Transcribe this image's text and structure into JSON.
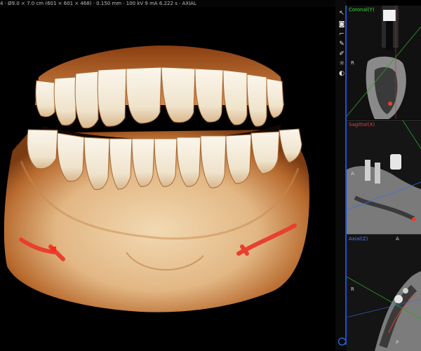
{
  "app": {
    "info_text": "4 · Ø9.0 × 7.0 cm (601 × 601 × 468) · 0.150 mm · 100 kV 9 mA 6.222 s · AXIAL"
  },
  "toolbar": {
    "icons": [
      "cursor-icon",
      "camera-icon",
      "ruler-icon",
      "wrench-icon",
      "pen-icon",
      "brightness-icon",
      "contrast-icon",
      "layers-icon"
    ]
  },
  "panels": {
    "coronal": {
      "label": "Coronal(Y)",
      "label_color": "#3ddc3d",
      "marker_left": "R"
    },
    "sagittal": {
      "label": "Sagittal(X)",
      "label_color": "#e04040",
      "marker_left": "A"
    },
    "axial": {
      "label": "Axial(Z)",
      "label_color": "#4a7dff",
      "marker_top": "A",
      "marker_left": "R",
      "marker_bottom": "P"
    }
  },
  "colors": {
    "bone": "#e8c79a",
    "enamel": "#f4eee2",
    "nerve_canal": "#e8402e",
    "accent_blue": "#1c4fd6"
  }
}
